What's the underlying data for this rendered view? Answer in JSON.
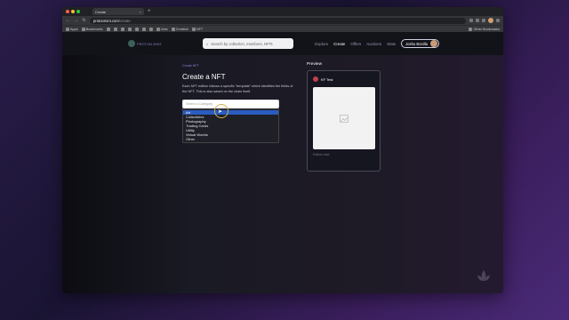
{
  "browser": {
    "tab_title": "Create",
    "tab_close": "×",
    "new_tab": "+",
    "url_host": "protonmint.com",
    "url_path": "/create",
    "nav": {
      "back": "←",
      "forward": "→",
      "reload": "↻"
    },
    "bookmarks": [
      {
        "label": "Apps"
      },
      {
        "label": "Bookmarks"
      },
      {
        "label": "Jobs"
      },
      {
        "label": "Creative"
      },
      {
        "label": "NFT"
      }
    ],
    "other_bookmarks": "Other Bookmarks"
  },
  "site": {
    "logo_text": "PROTON MINT",
    "search_placeholder": "Search by collection, members, NFTs",
    "nav_links": [
      {
        "label": "Explore",
        "active": false
      },
      {
        "label": "Create",
        "active": true
      },
      {
        "label": "Offers",
        "active": false
      },
      {
        "label": "Auctions",
        "active": false
      },
      {
        "label": "Stats",
        "active": false
      }
    ],
    "user_name": "Joshu Bonilla"
  },
  "form": {
    "breadcrumb": "Create NFT",
    "title": "Create a NFT",
    "description": "Each NFT edition follows a specific \"template\" which identifies the fields of the NFT. This is also saved on the chain itself.",
    "select_placeholder": "Select a Category",
    "options": [
      "Art",
      "Collectibles",
      "Photography",
      "Trading Cards",
      "Utility",
      "Virtual Worlds",
      "Other"
    ],
    "selected_index": 0
  },
  "preview": {
    "label": "Preview",
    "card_title": "KF Test",
    "edition_text": "Edition size:"
  }
}
